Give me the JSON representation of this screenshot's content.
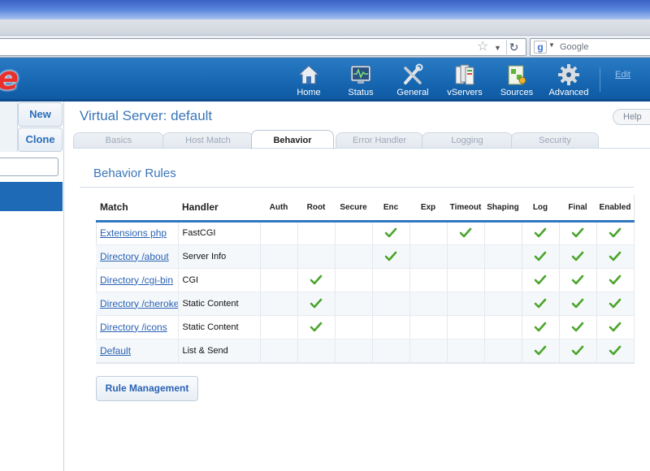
{
  "browser": {
    "search_placeholder": "Google"
  },
  "app": {
    "logo_text": "e",
    "nav": [
      {
        "label": "Home",
        "icon": "home-icon"
      },
      {
        "label": "Status",
        "icon": "status-monitor-icon"
      },
      {
        "label": "General",
        "icon": "tools-icon"
      },
      {
        "label": "vServers",
        "icon": "servers-icon"
      },
      {
        "label": "Sources",
        "icon": "sources-icon"
      },
      {
        "label": "Advanced",
        "icon": "gear-icon"
      }
    ],
    "edit_link": "Edit"
  },
  "sidebar": {
    "new_label": "New",
    "clone_label": "Clone"
  },
  "main": {
    "title": "Virtual Server: default",
    "help_label": "Help",
    "tabs": [
      {
        "label": "Basics",
        "active": false
      },
      {
        "label": "Host Match",
        "active": false
      },
      {
        "label": "Behavior",
        "active": true
      },
      {
        "label": "Error Handler",
        "active": false
      },
      {
        "label": "Logging",
        "active": false
      },
      {
        "label": "Security",
        "active": false
      }
    ],
    "section_title": "Behavior Rules",
    "table": {
      "columns": [
        "Match",
        "Handler",
        "Auth",
        "Root",
        "Secure",
        "Enc",
        "Exp",
        "Timeout",
        "Shaping",
        "Log",
        "Final",
        "Enabled"
      ],
      "rows": [
        {
          "match": "Extensions php",
          "handler": "FastCGI",
          "flags": [
            false,
            false,
            false,
            true,
            false,
            true,
            false,
            true,
            true,
            true
          ]
        },
        {
          "match": "Directory /about",
          "handler": "Server Info",
          "flags": [
            false,
            false,
            false,
            true,
            false,
            false,
            false,
            true,
            true,
            true
          ]
        },
        {
          "match": "Directory /cgi-bin",
          "handler": "CGI",
          "flags": [
            false,
            true,
            false,
            false,
            false,
            false,
            false,
            true,
            true,
            true
          ]
        },
        {
          "match": "Directory /cherokee_themes",
          "handler": "Static Content",
          "flags": [
            false,
            true,
            false,
            false,
            false,
            false,
            false,
            true,
            true,
            true
          ]
        },
        {
          "match": "Directory /icons",
          "handler": "Static Content",
          "flags": [
            false,
            true,
            false,
            false,
            false,
            false,
            false,
            true,
            true,
            true
          ]
        },
        {
          "match": "Default",
          "handler": "List & Send",
          "flags": [
            false,
            false,
            false,
            false,
            false,
            false,
            false,
            true,
            true,
            true
          ]
        }
      ]
    },
    "rule_management_label": "Rule Management"
  },
  "colors": {
    "header_blue": "#1868b3",
    "link_blue": "#2a62b3",
    "check_green": "#4aa52c",
    "logo_red": "#e8312c"
  }
}
